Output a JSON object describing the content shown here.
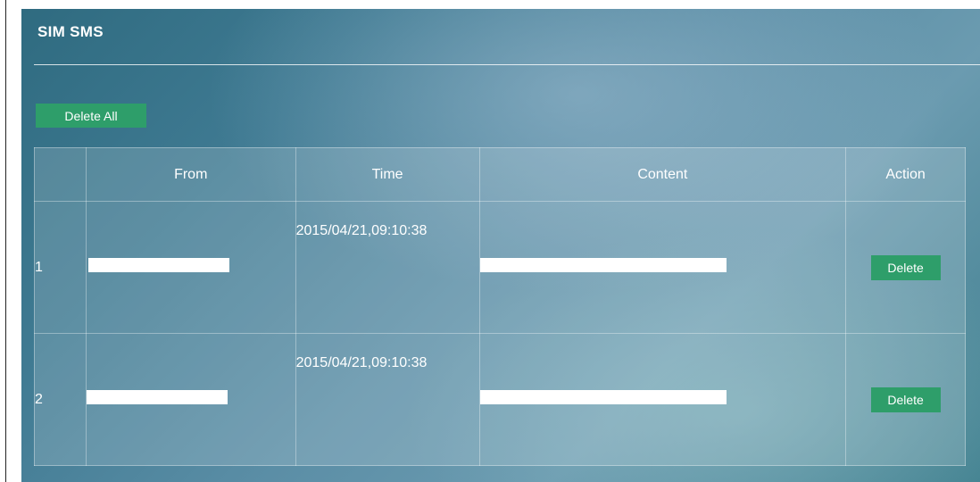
{
  "section": {
    "title": "SIM SMS",
    "delete_all_label": "Delete All"
  },
  "table": {
    "headers": [
      "",
      "From",
      "Time",
      "Content",
      "Action"
    ],
    "rows": [
      {
        "index": "1",
        "from": "",
        "time": "2015/04/21,09:10:38",
        "content": "",
        "action_label": "Delete"
      },
      {
        "index": "2",
        "from": "",
        "time": "2015/04/21,09:10:38",
        "content": "",
        "action_label": "Delete"
      }
    ]
  },
  "colors": {
    "accent_green": "#2e9e6a",
    "panel_teal": "#3f7a92"
  }
}
